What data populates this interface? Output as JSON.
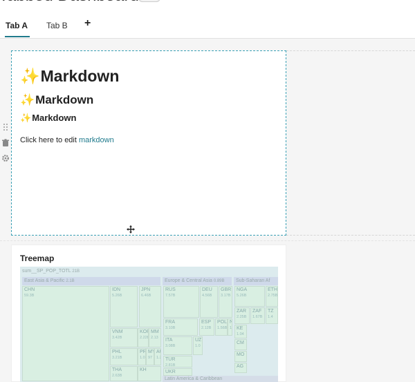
{
  "dashboard": {
    "title": "Tabbed Dashboard"
  },
  "tabs": [
    {
      "label": "Tab A",
      "active": true
    },
    {
      "label": "Tab B",
      "active": false
    }
  ],
  "add_tab_label": "+",
  "markdown": {
    "sparkle": "✨",
    "heading": "Markdown",
    "body_prefix": "Click here to edit ",
    "body_link": "markdown"
  },
  "treemap": {
    "title": "Treemap",
    "root_label": "sum__SP_POP_TOTL",
    "root_value": "21B",
    "regions": [
      {
        "label": "East Asia & Pacific",
        "value": "2.1B"
      },
      {
        "label": "Europe & Central Asia",
        "value": "0.89B"
      },
      {
        "label": "Sub-Saharan Af",
        "value": ""
      }
    ],
    "bottom_label": "Latin America & Caribbean",
    "cells": [
      {
        "name": "CHN",
        "value": "59.3B"
      },
      {
        "name": "IDN",
        "value": "5.26B"
      },
      {
        "name": "JPN",
        "value": "6.46B"
      },
      {
        "name": "VNM",
        "value": "3.42B"
      },
      {
        "name": "KOR",
        "value": "2.22B"
      },
      {
        "name": "MM",
        "value": "2.13"
      },
      {
        "name": "PHL",
        "value": "3.21B"
      },
      {
        "name": "PR",
        "value": "1.0"
      },
      {
        "name": "MY",
        "value": "97"
      },
      {
        "name": "AU",
        "value": "1.2"
      },
      {
        "name": "THA",
        "value": "2.63B"
      },
      {
        "name": "KH",
        "value": ""
      },
      {
        "name": "RUS",
        "value": "7.57B"
      },
      {
        "name": "DEU",
        "value": "4.56B"
      },
      {
        "name": "GBR",
        "value": "3.17B"
      },
      {
        "name": "FRA",
        "value": "3.10B"
      },
      {
        "name": "ESP",
        "value": "2.12B"
      },
      {
        "name": "POL",
        "value": "1.56B"
      },
      {
        "name": "NL",
        "value": "1.0"
      },
      {
        "name": "ITA",
        "value": "3.08B"
      },
      {
        "name": "UZ",
        "value": "1.0"
      },
      {
        "name": "TUR",
        "value": "2.81B"
      },
      {
        "name": "UKR",
        "value": "2.55B"
      },
      {
        "name": "NGA",
        "value": "5.26B"
      },
      {
        "name": "ETH",
        "value": "2.75B"
      },
      {
        "name": "ZAR",
        "value": "2.25B"
      },
      {
        "name": "ZAF",
        "value": "1.67B"
      },
      {
        "name": "TZ",
        "value": "1.4"
      },
      {
        "name": "KE",
        "value": "1.04"
      },
      {
        "name": "CM",
        "value": ""
      },
      {
        "name": "MO",
        "value": ""
      },
      {
        "name": "AG",
        "value": ""
      }
    ]
  },
  "colors": {
    "accent": "#1f7a8c",
    "treemap_bg": "#dcebee",
    "treemap_green": "#d9efe2",
    "sparkle": "#e7b416"
  },
  "icons": [
    "drag-handle-icon",
    "trash-icon",
    "gear-icon",
    "move-icon"
  ]
}
